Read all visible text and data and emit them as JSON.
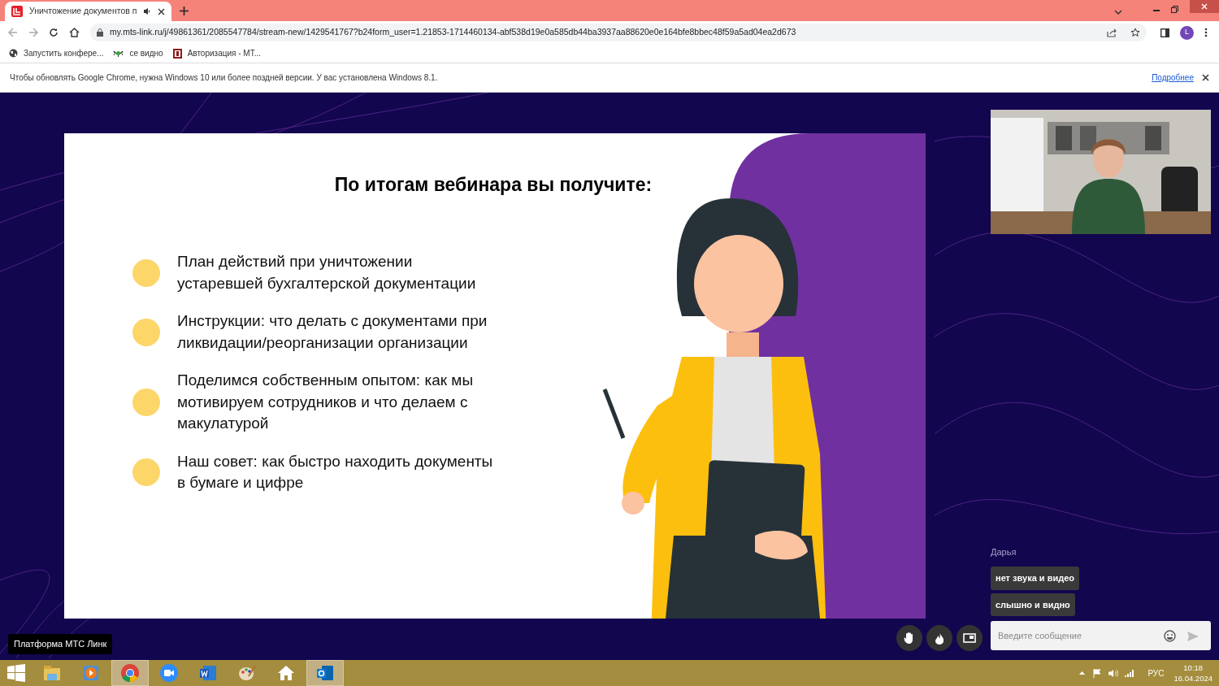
{
  "browser": {
    "tab": {
      "title": "Уничтожение документов п"
    },
    "url": "my.mts-link.ru/j/49861361/2085547784/stream-new/1429541767?b24form_user=1.21853-1714460134-abf538d19e0a585db44ba3937aa88620e0e164bfe8bbec48f59a5ad04ea2d673",
    "profile_initial": "L",
    "bookmarks": [
      {
        "kind": "globe",
        "label": "Запустить конфере..."
      },
      {
        "kind": "eye",
        "label": "се видно"
      },
      {
        "kind": "mark",
        "label": "Авторизация - МТ..."
      }
    ],
    "infobar": {
      "message": "Чтобы обновлять Google Chrome, нужна Windows 10 или более поздней версии. У вас установлена Windows 8.1.",
      "link": "Подробнее"
    }
  },
  "slide": {
    "title": "По итогам вебинара вы получите:",
    "bullets": [
      "План действий при уничтожении устаревшей бухгалтерской документации",
      "Инструкции: что делать с документами при ликвидации/реорганизации организации",
      "Поделимся собственным опытом: как мы мотивируем сотрудников и что делаем с макулатурой",
      "Наш совет: как быстро находить документы в бумаге и цифре"
    ]
  },
  "chat": {
    "author": "Дарья",
    "messages": [
      "нет звука и видео",
      "слышно и видно"
    ],
    "placeholder": "Введите сообщение"
  },
  "tooltip": "Платформа МТС Линк",
  "taskbar": {
    "apps": [
      {
        "kind": "explorer",
        "active": false
      },
      {
        "kind": "player",
        "active": false
      },
      {
        "kind": "chrome",
        "active": true
      },
      {
        "kind": "zoom",
        "active": false
      },
      {
        "kind": "word",
        "active": false
      },
      {
        "kind": "paint",
        "active": false
      },
      {
        "kind": "home",
        "active": false
      },
      {
        "kind": "outlook",
        "active": true
      }
    ],
    "language": "РУС",
    "time": "10:18",
    "date": "16.04.2024"
  }
}
